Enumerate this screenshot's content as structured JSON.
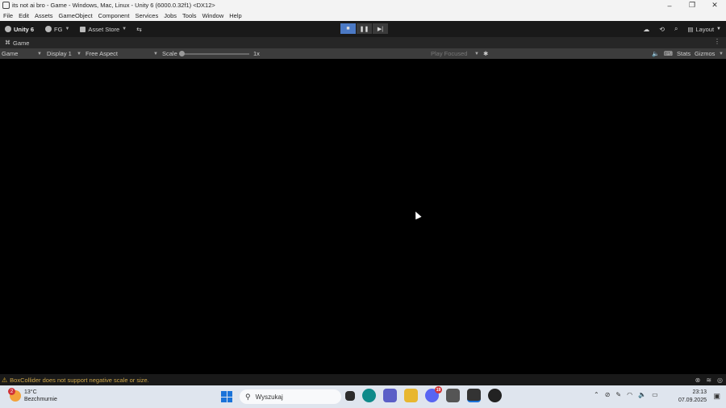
{
  "window": {
    "title": "its not ai bro - Game - Windows, Mac, Linux - Unity 6 (6000.0.32f1) <DX12>",
    "controls": {
      "minimize": "–",
      "restore": "❐",
      "close": "✕"
    }
  },
  "menu": [
    "File",
    "Edit",
    "Assets",
    "GameObject",
    "Component",
    "Services",
    "Jobs",
    "Tools",
    "Window",
    "Help"
  ],
  "toolbar": {
    "unity_label": "Unity 6",
    "account_label": "FG",
    "asset_store_label": "Asset Store",
    "play": {
      "play_icon": "■",
      "pause_icon": "❚❚",
      "step_icon": "▶|"
    },
    "layout_label": "Layout"
  },
  "tab": {
    "label": "Game",
    "menu_icon": "⋮"
  },
  "game_toolbar": {
    "view_label": "Game",
    "display_label": "Display 1",
    "aspect_label": "Free Aspect",
    "scale_label": "Scale",
    "scale_value": "1x",
    "play_mode_label": "Play Focused",
    "stats_label": "Stats",
    "gizmos_label": "Gizmos"
  },
  "status": {
    "warning_text": "BoxCollider does not support negative scale or size."
  },
  "taskbar": {
    "weather_temp": "13°C",
    "weather_desc": "Bezchmurnie",
    "weather_badge": "2",
    "search_placeholder": "Wyszukaj",
    "discord_badge": "19",
    "time": "23:13",
    "date": "07.09.2025"
  },
  "colors": {
    "accent": "#4b79c4",
    "warning": "#d0a84a",
    "taskbar": "#dfe5ee"
  }
}
